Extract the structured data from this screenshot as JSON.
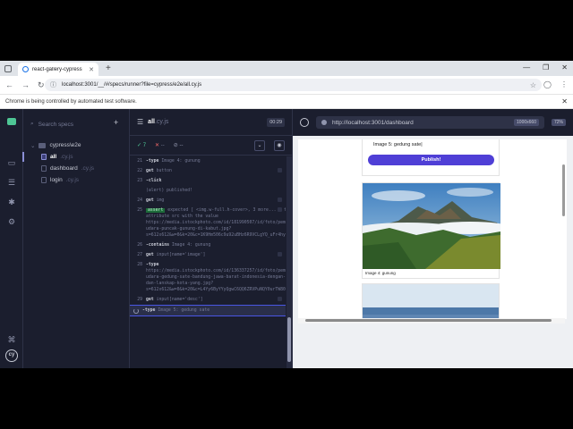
{
  "browser": {
    "tab_title": "react-gallery-cypress",
    "url": "localhost:3001/__/#/specs/runner?file=cypress/e2e/all.cy.js",
    "automation_notice": "Chrome is being controlled by automated test software."
  },
  "specs_panel": {
    "search_placeholder": "Search specs",
    "folder": "cypress\\e2e",
    "files": [
      {
        "name": "all",
        "ext": ".cy.js",
        "active": true
      },
      {
        "name": "dashboard",
        "ext": ".cy.js",
        "active": false
      },
      {
        "name": "login",
        "ext": ".cy.js",
        "active": false
      }
    ]
  },
  "reporter": {
    "file_name": "all",
    "file_ext": ".cy.js",
    "duration": "00:29",
    "passed": "7",
    "failed": "--",
    "pending": "--",
    "commands": [
      {
        "num": "21",
        "kw": "-type",
        "arg": "Image 4: gunung"
      },
      {
        "num": "22",
        "kw": "get",
        "arg": "button"
      },
      {
        "num": "23",
        "kw": "-click",
        "arg": ""
      },
      {
        "num": "",
        "kw": "",
        "arg": "(alert)  published!"
      },
      {
        "num": "24",
        "kw": "get",
        "arg": "img"
      },
      {
        "num": "25",
        "kw": "",
        "badge": "assert",
        "arg": "expected [ <img.w-full.h-cover>, 3 more... ] to have attribute src with the value https://media.istockphoto.com/id/181990507/id/foto/pemandangan-udara-puncak-gunung-di-kabut.jpg?s=612x612&w=0&k=20&c=1K9Hm506c9u92uBHz6R9VCLgYQ_uFr4hyVMGcw0Ui="
      },
      {
        "num": "26",
        "kw": "-contains",
        "arg": "Image 4: gunung"
      },
      {
        "num": "27",
        "kw": "get",
        "arg": "input[name='image']"
      },
      {
        "num": "28",
        "kw": "-type",
        "arg": "https://media.istockphoto.com/id/136337257/id/foto/pemandangan-udara-gedung-sate-bandung-jawa-barat-indonesia-dengan-langit-dan-lanskap-kota-yang.jpg?s=612x612&w=0&k=20&c=L4Yy6ByYYyQgwC6QQ6ZRVPuNQY0urTW80kuaX9zvw="
      },
      {
        "num": "29",
        "kw": "get",
        "arg": "input[name='desc']"
      },
      {
        "num": "",
        "kw": "-type",
        "arg": "Image 5: gedung sate",
        "current": true
      }
    ]
  },
  "aut": {
    "url": "http://localhost:3001/dashboard",
    "viewport_size": "1000x660",
    "zoom": "72%",
    "form_caption": "Image 5: gedung sate|",
    "publish_label": "Publish!",
    "image_caption": "Image 4: gunung"
  },
  "colors": {
    "cypress_bg": "#1b1e2e",
    "publish": "#4f3fd6",
    "pass": "#4ec695",
    "fail": "#f56a6a"
  }
}
